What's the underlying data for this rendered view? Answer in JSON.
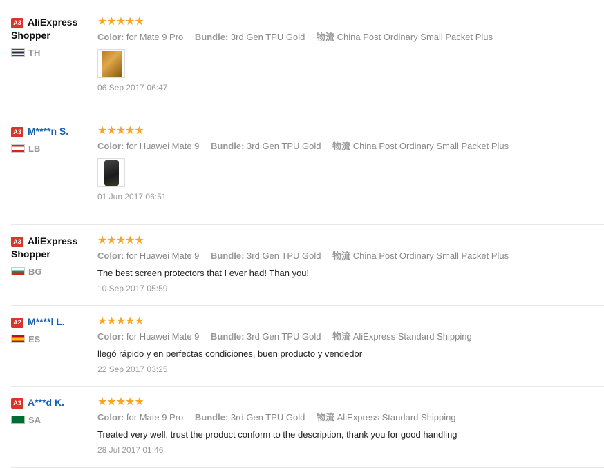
{
  "labels": {
    "color": "Color:",
    "bundle": "Bundle:",
    "shipping": "物流"
  },
  "reviews": [
    {
      "badge": "A3",
      "name": "AliExpress Shopper",
      "country": "TH",
      "color": "for Mate 9 Pro",
      "bundle": "3rd Gen TPU Gold",
      "shipping": "China Post Ordinary Small Packet Plus",
      "text": "",
      "date": "06 Sep 2017 06:47"
    },
    {
      "badge": "A3",
      "name": "M****n S.",
      "country": "LB",
      "color": "for Huawei Mate 9",
      "bundle": "3rd Gen TPU Gold",
      "shipping": "China Post Ordinary Small Packet Plus",
      "text": "",
      "date": "01 Jun 2017 06:51"
    },
    {
      "badge": "A3",
      "name": "AliExpress Shopper",
      "country": "BG",
      "color": "for Huawei Mate 9",
      "bundle": "3rd Gen TPU Gold",
      "shipping": "China Post Ordinary Small Packet Plus",
      "text": "The best screen protectors that I ever had! Than you!",
      "date": "10 Sep 2017 05:59"
    },
    {
      "badge": "A2",
      "name": "M****l L.",
      "country": "ES",
      "color": "for Huawei Mate 9",
      "bundle": "3rd Gen TPU Gold",
      "shipping": "AliExpress Standard Shipping",
      "text": "llegó rápido y en perfectas condiciones, buen producto y vendedor",
      "date": "22 Sep 2017 03:25"
    },
    {
      "badge": "A3",
      "name": "A***d K.",
      "country": "SA",
      "color": "for Mate 9 Pro",
      "bundle": "3rd Gen TPU Gold",
      "shipping": "AliExpress Standard Shipping",
      "text": "Treated very well, trust the product conform to the description, thank you for good handling",
      "date": "28 Jul 2017 01:46"
    }
  ],
  "stars": "★★★★★",
  "rating_value": 5,
  "rating_max": 5
}
